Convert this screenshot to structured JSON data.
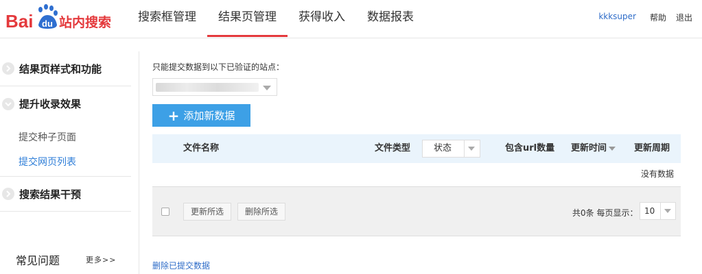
{
  "brand": {
    "logo_text_left": "Bai",
    "logo_text_du": "du",
    "logo_text_right": "站内搜索",
    "red": "#e4393c",
    "blue": "#2f6fd0"
  },
  "nav": {
    "items": [
      "搜索框管理",
      "结果页管理",
      "获得收入",
      "数据报表"
    ],
    "active_index": 1
  },
  "userbar": {
    "username": "kkksuper",
    "help": "帮助",
    "logout": "退出"
  },
  "sidebar": {
    "groups": [
      {
        "label": "结果页样式和功能"
      },
      {
        "label": "提升收录效果",
        "subs": [
          "提交种子页面",
          "提交网页列表"
        ],
        "active_sub": 1
      },
      {
        "label": "搜索结果干预"
      }
    ],
    "faq": "常见问题",
    "faq_more": "更多>>"
  },
  "main": {
    "hint": "只能提交数据到以下已验证的站点：",
    "site_select_value": "",
    "add_button": "添加新数据",
    "columns": {
      "filename": "文件名称",
      "filetype": "文件类型",
      "state": "状态",
      "url_count": "包含url数量",
      "updated": "更新时间",
      "period": "更新周期"
    },
    "empty_text": "没有数据",
    "update_selected": "更新所选",
    "delete_selected": "删除所选",
    "page_info": "共0条 每页显示：",
    "page_size": "10",
    "delete_link": "删除已提交数据"
  }
}
